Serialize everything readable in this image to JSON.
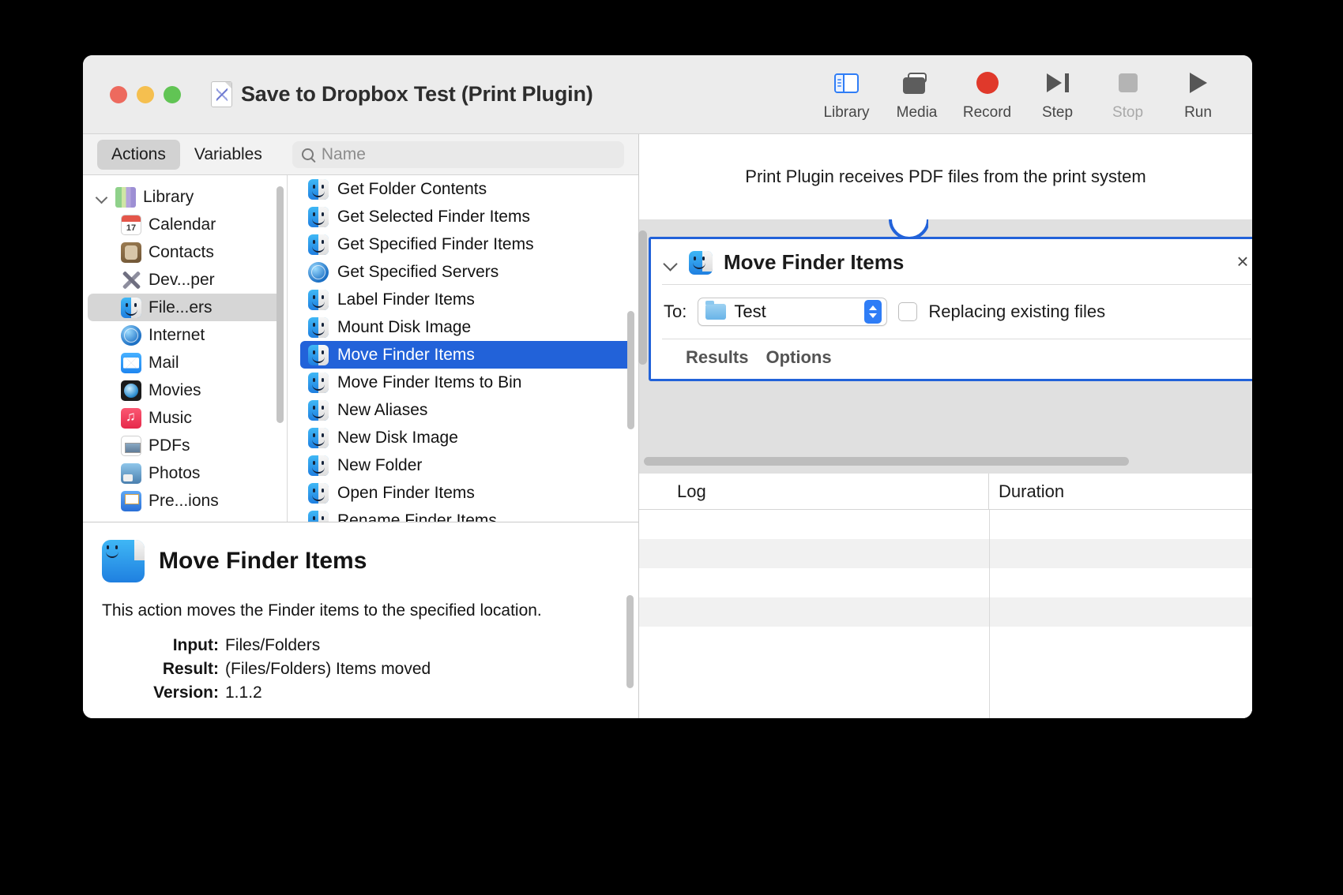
{
  "window": {
    "title": "Save to Dropbox Test (Print Plugin)",
    "doc_icon": "automator-document-icon"
  },
  "toolbar": {
    "items": [
      {
        "label": "Library",
        "icon": "library-sidebar-icon",
        "disabled": false
      },
      {
        "label": "Media",
        "icon": "media-photos-icon",
        "disabled": false
      },
      {
        "label": "Record",
        "icon": "record-circle-icon",
        "disabled": false
      },
      {
        "label": "Step",
        "icon": "step-forward-icon",
        "disabled": false
      },
      {
        "label": "Stop",
        "icon": "stop-square-icon",
        "disabled": true
      },
      {
        "label": "Run",
        "icon": "run-play-icon",
        "disabled": false
      }
    ]
  },
  "left_panel": {
    "tabs": [
      {
        "label": "Actions",
        "active": true
      },
      {
        "label": "Variables",
        "active": false
      }
    ],
    "search": {
      "placeholder": "Name",
      "value": "",
      "icon": "search-icon"
    },
    "library": {
      "root": {
        "label": "Library",
        "icon": "library-books-icon",
        "expanded": true
      },
      "items": [
        {
          "label": "Calendar",
          "icon": "calendar-icon",
          "selected": false
        },
        {
          "label": "Contacts",
          "icon": "contacts-icon",
          "selected": false
        },
        {
          "label": "Dev...per",
          "icon": "developer-icon",
          "selected": false
        },
        {
          "label": "File...ers",
          "icon": "finder-icon",
          "selected": true
        },
        {
          "label": "Internet",
          "icon": "internet-icon",
          "selected": false
        },
        {
          "label": "Mail",
          "icon": "mail-icon",
          "selected": false
        },
        {
          "label": "Movies",
          "icon": "movies-icon",
          "selected": false
        },
        {
          "label": "Music",
          "icon": "music-icon",
          "selected": false
        },
        {
          "label": "PDFs",
          "icon": "pdf-icon",
          "selected": false
        },
        {
          "label": "Photos",
          "icon": "photos-icon",
          "selected": false
        },
        {
          "label": "Pre...ions",
          "icon": "keynote-icon",
          "selected": false
        }
      ]
    },
    "actions": [
      {
        "label": "Get Folder Contents",
        "icon": "finder-icon",
        "selected": false
      },
      {
        "label": "Get Selected Finder Items",
        "icon": "finder-icon",
        "selected": false
      },
      {
        "label": "Get Specified Finder Items",
        "icon": "finder-icon",
        "selected": false
      },
      {
        "label": "Get Specified Servers",
        "icon": "internet-icon",
        "selected": false
      },
      {
        "label": "Label Finder Items",
        "icon": "finder-icon",
        "selected": false
      },
      {
        "label": "Mount Disk Image",
        "icon": "finder-icon",
        "selected": false
      },
      {
        "label": "Move Finder Items",
        "icon": "finder-icon",
        "selected": true
      },
      {
        "label": "Move Finder Items to Bin",
        "icon": "finder-icon",
        "selected": false
      },
      {
        "label": "New Aliases",
        "icon": "finder-icon",
        "selected": false
      },
      {
        "label": "New Disk Image",
        "icon": "finder-icon",
        "selected": false
      },
      {
        "label": "New Folder",
        "icon": "finder-icon",
        "selected": false
      },
      {
        "label": "Open Finder Items",
        "icon": "finder-icon",
        "selected": false
      },
      {
        "label": "Rename Finder Items",
        "icon": "finder-icon",
        "selected": false
      }
    ],
    "description": {
      "title": "Move Finder Items",
      "icon": "finder-icon",
      "summary": "This action moves the Finder items to the specified location.",
      "fields": [
        {
          "key": "Input:",
          "value": "Files/Folders"
        },
        {
          "key": "Result:",
          "value": "(Files/Folders) Items moved"
        },
        {
          "key": "Version:",
          "value": "1.1.2"
        }
      ]
    }
  },
  "workflow": {
    "header_text": "Print Plugin receives PDF files from the print system",
    "action_card": {
      "title": "Move Finder Items",
      "icon": "finder-icon",
      "disclosure": "chevron-down-icon",
      "close": "×",
      "to_label": "To:",
      "to_value": "Test",
      "to_icon": "folder-icon",
      "checkbox": {
        "label": "Replacing existing files",
        "checked": false
      },
      "tabs": [
        {
          "label": "Results"
        },
        {
          "label": "Options"
        }
      ]
    }
  },
  "log": {
    "columns": [
      "Log",
      "Duration"
    ],
    "rows": []
  },
  "statusbar": {
    "left": [
      {
        "icon": "ellipsis-menu-icon"
      },
      {
        "icon": "disclosure-chevron-icon"
      }
    ],
    "right": [
      {
        "icon": "list-view-icon"
      },
      {
        "icon": "split-view-icon"
      }
    ]
  },
  "colors": {
    "accent": "#2262d9",
    "selection": "#2262d9",
    "record": "#e0392b",
    "titlebar": "#ececec"
  }
}
